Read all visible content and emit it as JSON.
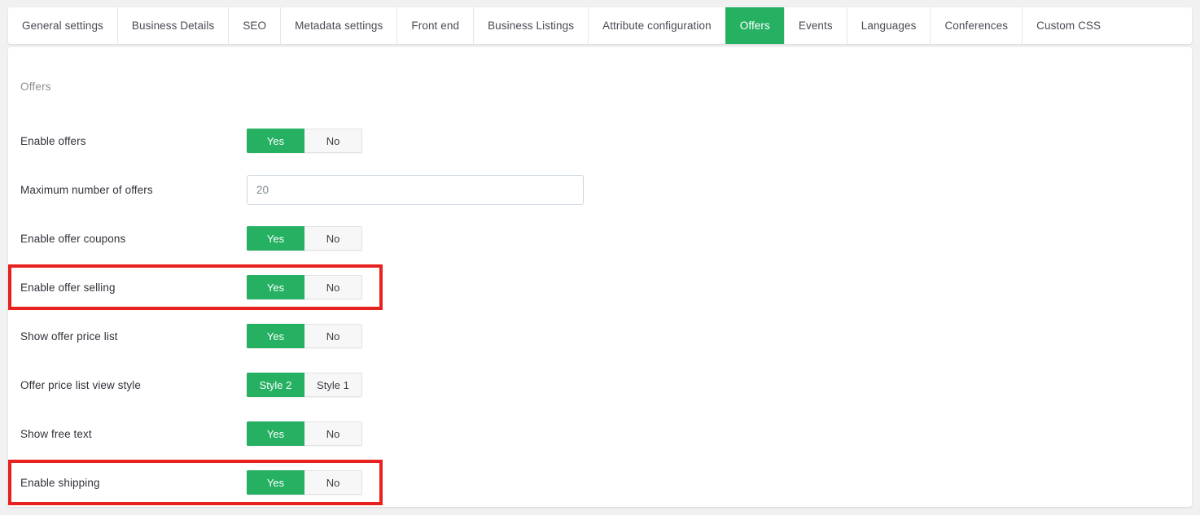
{
  "tabs": [
    {
      "label": "General settings",
      "active": false
    },
    {
      "label": "Business Details",
      "active": false
    },
    {
      "label": "SEO",
      "active": false
    },
    {
      "label": "Metadata settings",
      "active": false
    },
    {
      "label": "Front end",
      "active": false
    },
    {
      "label": "Business Listings",
      "active": false
    },
    {
      "label": "Attribute configuration",
      "active": false
    },
    {
      "label": "Offers",
      "active": true
    },
    {
      "label": "Events",
      "active": false
    },
    {
      "label": "Languages",
      "active": false
    },
    {
      "label": "Conferences",
      "active": false
    },
    {
      "label": "Custom CSS",
      "active": false
    }
  ],
  "panel": {
    "section_title": "Offers",
    "rows": [
      {
        "label": "Enable offers",
        "type": "toggle",
        "options": [
          "Yes",
          "No"
        ],
        "selected": "Yes",
        "highlighted": false
      },
      {
        "label": "Maximum number of offers",
        "type": "input",
        "value": "20",
        "placeholder": "20",
        "highlighted": false
      },
      {
        "label": "Enable offer coupons",
        "type": "toggle",
        "options": [
          "Yes",
          "No"
        ],
        "selected": "Yes",
        "highlighted": false
      },
      {
        "label": "Enable offer selling",
        "type": "toggle",
        "options": [
          "Yes",
          "No"
        ],
        "selected": "Yes",
        "highlighted": true
      },
      {
        "label": "Show offer price list",
        "type": "toggle",
        "options": [
          "Yes",
          "No"
        ],
        "selected": "Yes",
        "highlighted": false
      },
      {
        "label": "Offer price list view style",
        "type": "toggle",
        "options": [
          "Style 2",
          "Style 1"
        ],
        "selected": "Style 2",
        "highlighted": false
      },
      {
        "label": "Show free text",
        "type": "toggle",
        "options": [
          "Yes",
          "No"
        ],
        "selected": "Yes",
        "highlighted": false
      },
      {
        "label": "Enable shipping",
        "type": "toggle",
        "options": [
          "Yes",
          "No"
        ],
        "selected": "Yes",
        "highlighted": true
      }
    ]
  },
  "colors": {
    "accent_green": "#25b062",
    "highlight_red": "#e8201e",
    "page_background": "#f1f1f1",
    "card_background": "#ffffff",
    "label_text": "#31313a",
    "muted_text": "#8d8d93"
  }
}
